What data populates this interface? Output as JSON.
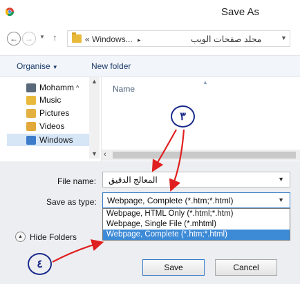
{
  "window": {
    "title": "Save As"
  },
  "address_bar": {
    "path_prefix": "« Windows...",
    "separator": "▸",
    "current_folder": "مجلد صفحات الويب"
  },
  "toolbar": {
    "organise": "Organise",
    "new_folder": "New folder"
  },
  "nav_pane": {
    "items": [
      {
        "label": "Mohamm"
      },
      {
        "label": "Music"
      },
      {
        "label": "Pictures"
      },
      {
        "label": "Videos"
      },
      {
        "label": "Windows"
      }
    ]
  },
  "file_list": {
    "column_header": "Name"
  },
  "form": {
    "file_name_label": "File name:",
    "file_name_value": "المعالج الدقيق",
    "save_as_type_label": "Save as type:",
    "save_as_type_value": "Webpage, Complete (*.htm;*.html)",
    "type_options": [
      {
        "label": "Webpage, HTML Only (*.html;*.htm)"
      },
      {
        "label": "Webpage, Single File (*.mhtml)"
      },
      {
        "label": "Webpage, Complete (*.htm;*.html)"
      }
    ]
  },
  "footer": {
    "hide_folders": "Hide Folders",
    "save_label": "Save",
    "cancel_label": "Cancel"
  },
  "annotations": {
    "marker_3": "٣",
    "marker_4": "٤",
    "arrow_color": "#e02020",
    "circle_color": "#1a2a8a"
  }
}
